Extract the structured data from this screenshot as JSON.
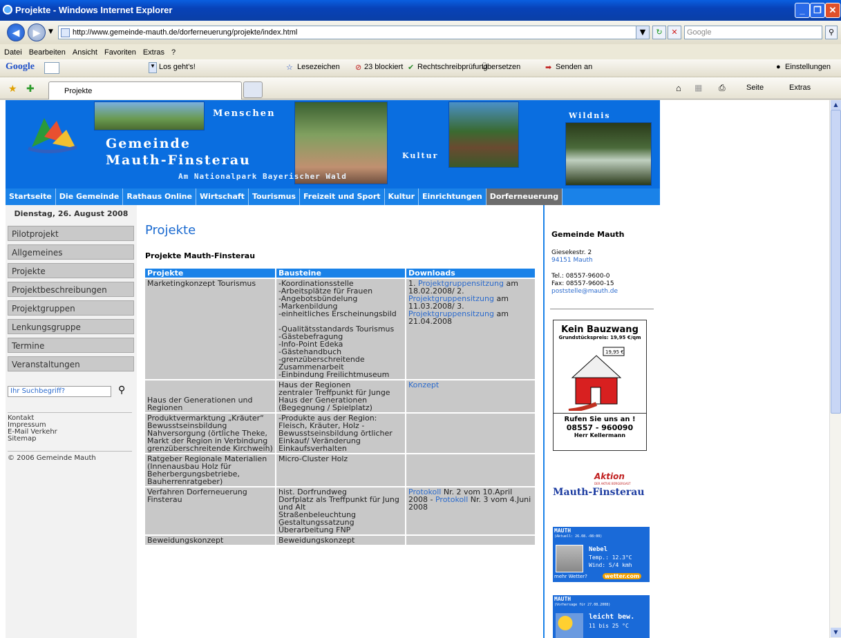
{
  "window": {
    "title": "Projekte - Windows Internet Explorer"
  },
  "address": {
    "url": "http://www.gemeinde-mauth.de/dorferneuerung/projekte/index.html",
    "search_placeholder": "Google"
  },
  "menu": [
    "Datei",
    "Bearbeiten",
    "Ansicht",
    "Favoriten",
    "Extras",
    "?"
  ],
  "googlebar": {
    "brand": "Google",
    "go": "Los geht's!",
    "bookmarks": "Lesezeichen",
    "blocked": "23 blockiert",
    "spell": "Rechtschreibprüfung",
    "translate": "Übersetzen",
    "send": "Senden an",
    "settings": "Einstellungen"
  },
  "tabs": {
    "active": "Projekte",
    "page_btn": "Seite",
    "extras_btn": "Extras"
  },
  "header": {
    "menschen": "Menschen",
    "wildnis": "Wildnis",
    "kultur": "Kultur",
    "gemeinde": "Gemeinde",
    "mauth": "Mauth-Finsterau",
    "tagline": "Am Nationalpark Bayerischer Wald"
  },
  "topnav": [
    "Startseite",
    "Die Gemeinde",
    "Rathaus Online",
    "Wirtschaft",
    "Tourismus",
    "Freizeit und Sport",
    "Kultur",
    "Einrichtungen",
    "Dorferneuerung"
  ],
  "left": {
    "date": "Dienstag, 26. August 2008",
    "nav": [
      "Pilotprojekt",
      "Allgemeines",
      "Projekte",
      "Projektbeschreibungen",
      "Projektgruppen",
      "Lenkungsgruppe",
      "Termine",
      "Veranstaltungen"
    ],
    "search_placeholder": "Ihr Suchbegriff?",
    "links": [
      "Kontakt",
      "Impressum",
      "E-Mail Verkehr",
      "Sitemap"
    ],
    "copyright": "© 2006 Gemeinde Mauth"
  },
  "main": {
    "title": "Projekte",
    "subtitle": "Projekte Mauth-Finsterau",
    "headers": [
      "Projekte",
      "Bausteine",
      "Downloads"
    ],
    "rows": [
      {
        "p": "Marketingkonzept Tourismus",
        "b": "-Koordinationsstelle\n-Arbeitsplätze für Frauen\n-Angebotsbündelung\n-Markenbildung\n-einheitliches Erscheinungsbild\n\n-Qualitätsstandards Tourismus\n-Gästebefragung\n-Info-Point Edeka\n-Gästehandbuch\n-grenzüberschreitende Zusammenarbeit\n-Einbindung Freilichtmuseum",
        "d": "1. Projektgruppensitzung am 18.02.2008/ 2. Projektgruppensitzung am 11.03.2008/ 3. Projektgruppensitzung am 21.04.2008"
      },
      {
        "p": "\n\nHaus der Generationen und Regionen",
        "b": "Haus der Regionen\nzentraler Treffpunkt für Junge Haus der Generationen (Begegnung / Spielplatz)",
        "d": "Konzept"
      },
      {
        "p": "Produktvermarktung „Kräuter“ Bewusstseinsbildung Nahversorgung (örtliche Theke, Markt der Region in Verbindung grenzüberschreitende Kirchweih)",
        "b": "-Produkte aus der Region: Fleisch, Kräuter, Holz - Bewusstseinsbildung örtlicher Einkauf/ Veränderung Einkaufsverhalten",
        "d": ""
      },
      {
        "p": "Ratgeber Regionale Materialien\n(Innenausbau Holz für Beherbergungsbetriebe, Bauherrenratgeber)",
        "b": "Micro-Cluster Holz",
        "d": ""
      },
      {
        "p": "Verfahren Dorferneuerung Finsterau",
        "b": "hist. Dorfrundweg\nDorfplatz als Treffpunkt für Jung und Alt\nStraßenbeleuchtung\nGestaltungssatzung\nÜberarbeitung FNP",
        "d": "Protokoll Nr. 2 vom 10.April 2008 - Protokoll Nr. 3 vom 4.Juni 2008"
      },
      {
        "p": "Beweidungskonzept",
        "b": "Beweidungskonzept",
        "d": ""
      }
    ]
  },
  "right": {
    "name": "Gemeinde Mauth",
    "street": "Giesekestr. 2",
    "city": "94151 Mauth",
    "tel": "Tel.: 08557-9600-0",
    "fax": "Fax: 08557-9600-15",
    "email": "poststelle@mauth.de",
    "ad": {
      "title": "Kein Bauzwang",
      "price": "Grundstückspreis: 19,95 €/qm",
      "sign": "19,95 €",
      "call": "Rufen Sie uns an !",
      "phone": "08557 - 960090",
      "person": "Herr Kellermann"
    },
    "aktion": {
      "word": "Aktion",
      "small": "DER AKTIVE BÜRGERGAST",
      "name": "Mauth-Finsterau"
    },
    "weather1": {
      "title": "MAUTH",
      "sub": "(Aktuell: 26.08.-08:00)",
      "cond": "Nebel",
      "temp": "Temp.: 12.3°C",
      "wind": "Wind: S/4 kmh",
      "more": "mehr Wetter?",
      "brand": "wetter.com"
    },
    "weather2": {
      "title": "MAUTH",
      "sub": "(Vorhersage für 27.08.2008)",
      "cond": "leicht bew.",
      "range": "11 bis 25 °C"
    }
  }
}
